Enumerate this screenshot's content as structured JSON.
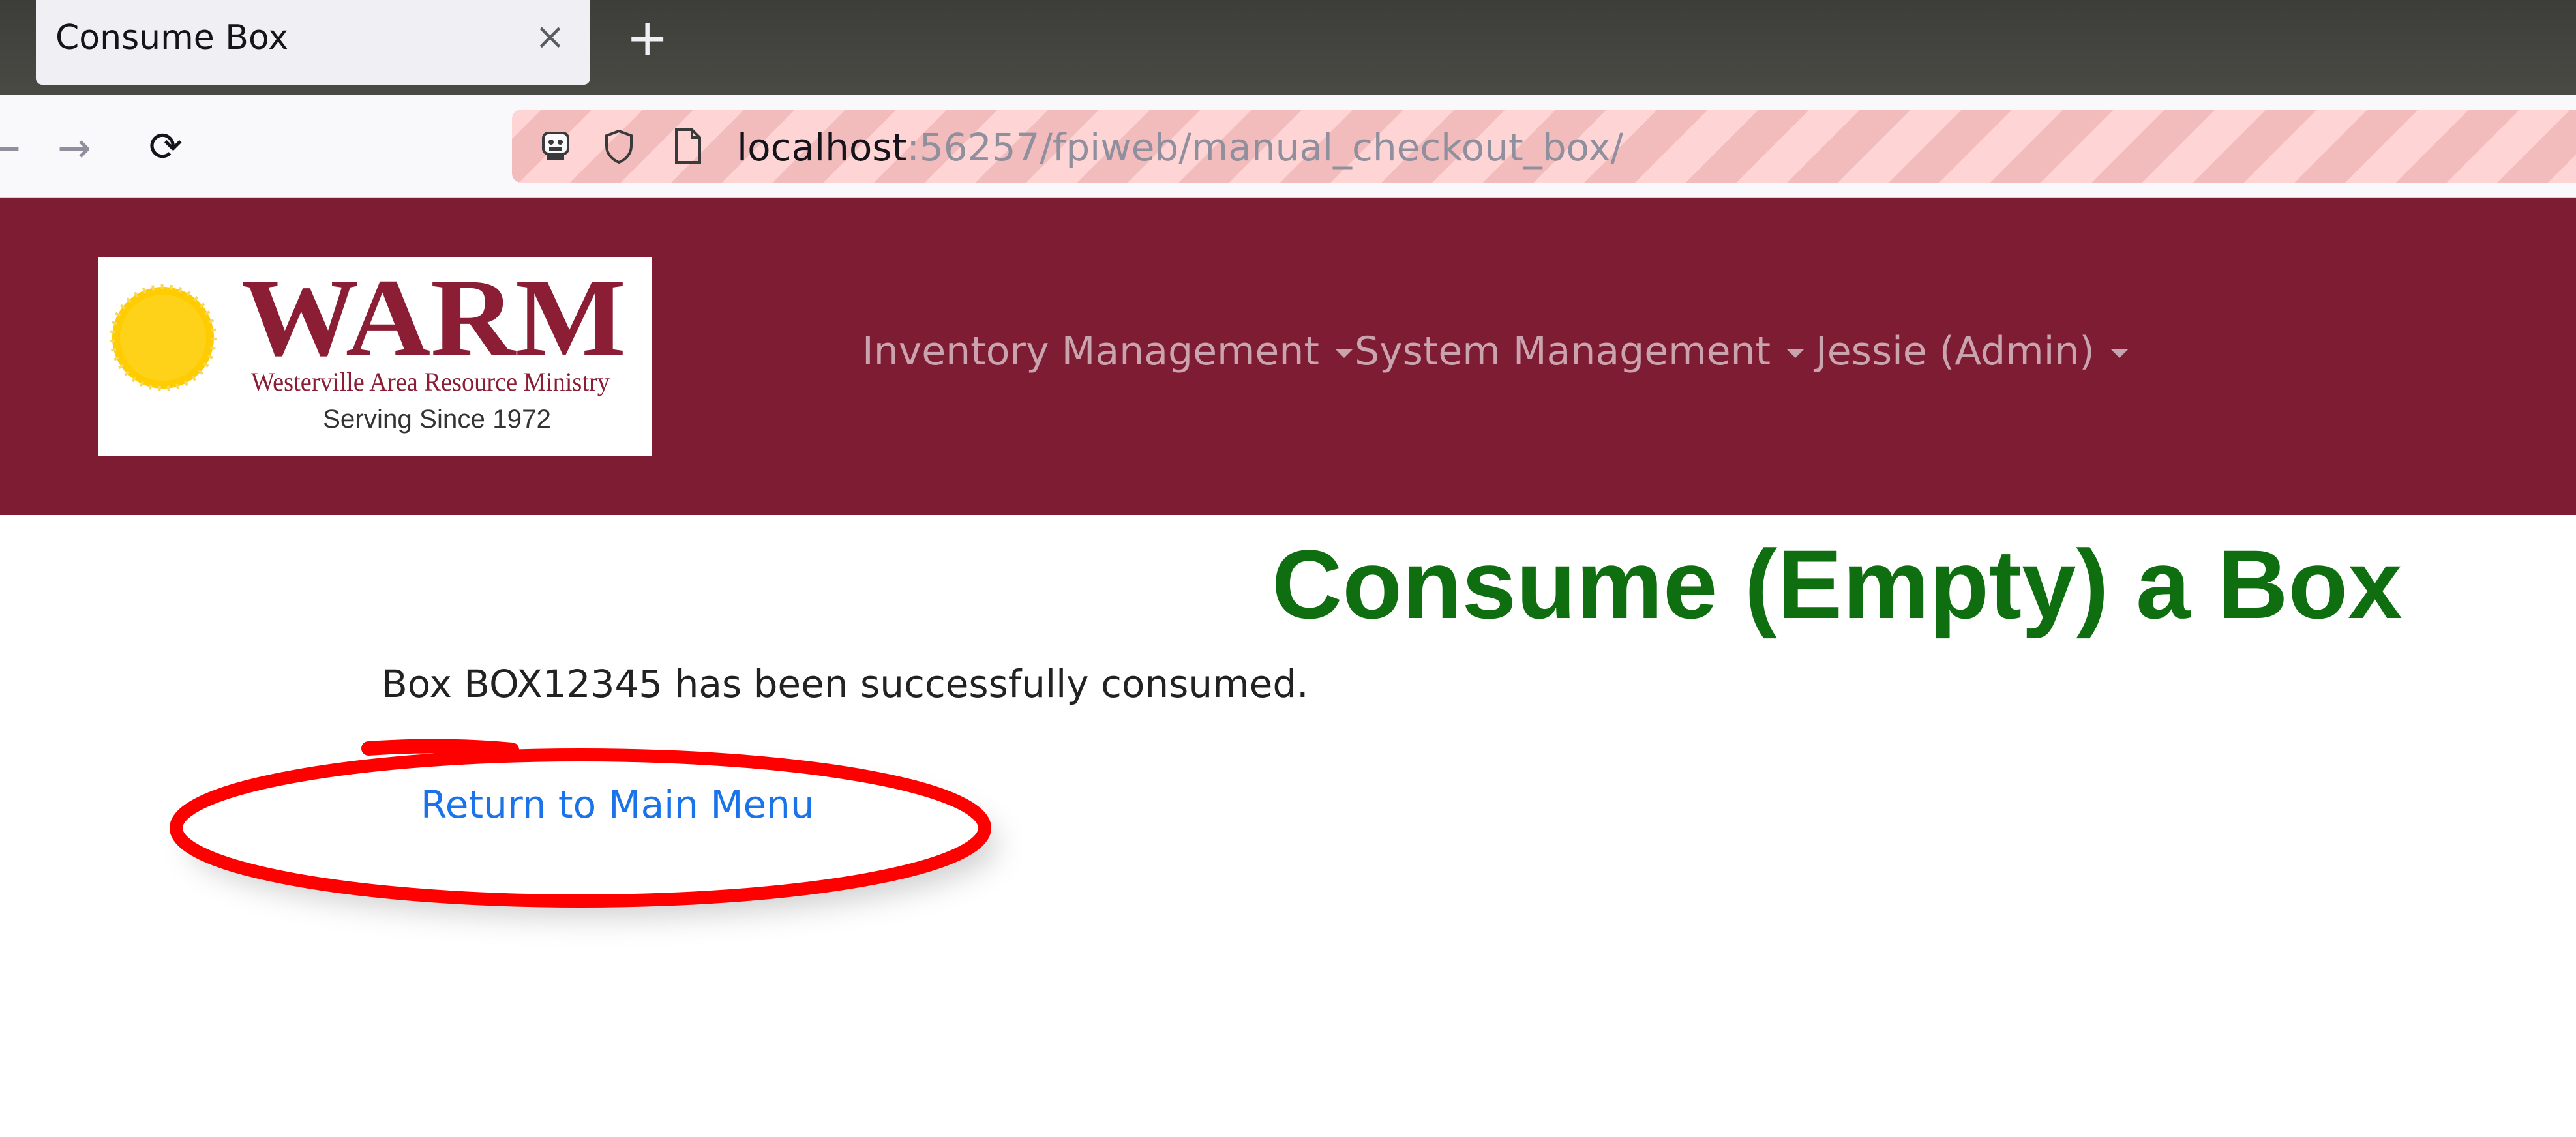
{
  "browser": {
    "tab_title": "Consume Box",
    "tab_close": "×",
    "new_tab": "+",
    "back": "←",
    "forward": "→",
    "reload": "⟳",
    "url_host": "localhost",
    "url_path": ":56257/fpiweb/manual_checkout_box/",
    "icons": [
      "robot-icon",
      "shield-icon",
      "page-icon"
    ]
  },
  "header": {
    "background_color": "#7e1c34",
    "logo": {
      "title": "WARM",
      "subtitle": "Westerville Area Resource Ministry",
      "tagline": "Serving Since 1972",
      "sun_color": "#ffcc00",
      "text_color": "#8b1d35"
    },
    "nav": [
      {
        "label": "Inventory Management"
      },
      {
        "label": "System Management"
      },
      {
        "label": "Jessie (Admin)"
      }
    ]
  },
  "main": {
    "title": "Consume (Empty) a Box",
    "title_color": "#0f6e0f",
    "message": "Box BOX12345 has been successfully consumed.",
    "return_link": "Return to Main Menu",
    "link_color": "#1a73e8"
  },
  "annotation": {
    "shape": "ellipse",
    "color": "#ff0000",
    "target": "return-to-main-menu-link"
  }
}
